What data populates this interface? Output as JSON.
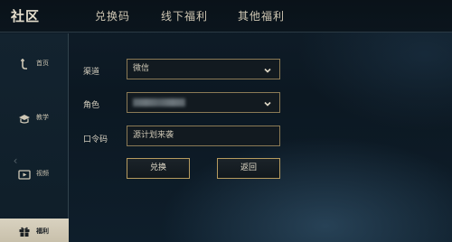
{
  "header": {
    "title": "社区",
    "tabs": [
      {
        "label": "兑换码"
      },
      {
        "label": "线下福利"
      },
      {
        "label": "其他福利"
      }
    ]
  },
  "sidebar": {
    "items": [
      {
        "label": "首页",
        "icon": "home-icon"
      },
      {
        "label": "教学",
        "icon": "graduation-icon"
      },
      {
        "label": "视频",
        "icon": "video-icon"
      },
      {
        "label": "福利",
        "icon": "gift-icon",
        "active": true
      }
    ]
  },
  "form": {
    "channel_label": "渠道",
    "channel_value": "微信",
    "role_label": "角色",
    "code_label": "口令码",
    "code_value": "源计划来袭"
  },
  "buttons": {
    "exchange": "兑换",
    "back": "返回"
  },
  "colors": {
    "accent_border": "#b69b5f",
    "background": "#0c1822",
    "active_tab_bg": "#d9d2c0"
  }
}
